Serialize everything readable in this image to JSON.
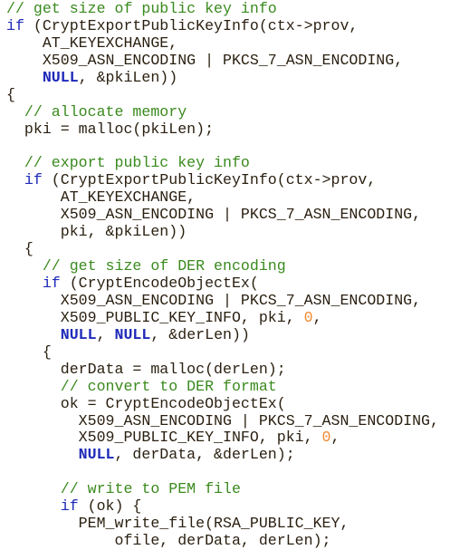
{
  "colors": {
    "comment": "#3a8a1e",
    "keyword": "#1f2ab8",
    "number": "#f08a30",
    "text": "#2a1f10"
  },
  "lines": [
    [
      {
        "k": "c",
        "s": "// get size of public key info"
      }
    ],
    [
      {
        "k": "k",
        "s": "if"
      },
      {
        "k": "t",
        "s": " (CryptExportPublicKeyInfo(ctx->prov,"
      }
    ],
    [
      {
        "k": "t",
        "s": "    AT_KEYEXCHANGE,"
      }
    ],
    [
      {
        "k": "t",
        "s": "    X509_ASN_ENCODING | PKCS_7_ASN_ENCODING,"
      }
    ],
    [
      {
        "k": "t",
        "s": "    "
      },
      {
        "k": "kb",
        "s": "NULL"
      },
      {
        "k": "t",
        "s": ", &pkiLen))"
      }
    ],
    [
      {
        "k": "t",
        "s": "{"
      }
    ],
    [
      {
        "k": "c",
        "s": "  // allocate memory"
      }
    ],
    [
      {
        "k": "t",
        "s": "  pki = malloc(pkiLen);"
      }
    ],
    [],
    [
      {
        "k": "c",
        "s": "  // export public key info"
      }
    ],
    [
      {
        "k": "t",
        "s": "  "
      },
      {
        "k": "k",
        "s": "if"
      },
      {
        "k": "t",
        "s": " (CryptExportPublicKeyInfo(ctx->prov,"
      }
    ],
    [
      {
        "k": "t",
        "s": "      AT_KEYEXCHANGE,"
      }
    ],
    [
      {
        "k": "t",
        "s": "      X509_ASN_ENCODING | PKCS_7_ASN_ENCODING,"
      }
    ],
    [
      {
        "k": "t",
        "s": "      pki, &pkiLen))"
      }
    ],
    [
      {
        "k": "t",
        "s": "  {"
      }
    ],
    [
      {
        "k": "c",
        "s": "    // get size of DER encoding"
      }
    ],
    [
      {
        "k": "t",
        "s": "    "
      },
      {
        "k": "k",
        "s": "if"
      },
      {
        "k": "t",
        "s": " (CryptEncodeObjectEx("
      }
    ],
    [
      {
        "k": "t",
        "s": "      X509_ASN_ENCODING | PKCS_7_ASN_ENCODING,"
      }
    ],
    [
      {
        "k": "t",
        "s": "      X509_PUBLIC_KEY_INFO, pki, "
      },
      {
        "k": "n",
        "s": "0"
      },
      {
        "k": "t",
        "s": ","
      }
    ],
    [
      {
        "k": "t",
        "s": "      "
      },
      {
        "k": "kb",
        "s": "NULL"
      },
      {
        "k": "t",
        "s": ", "
      },
      {
        "k": "kb",
        "s": "NULL"
      },
      {
        "k": "t",
        "s": ", &derLen))"
      }
    ],
    [
      {
        "k": "t",
        "s": "    {"
      }
    ],
    [
      {
        "k": "t",
        "s": "      derData = malloc(derLen);"
      }
    ],
    [
      {
        "k": "c",
        "s": "      // convert to DER format"
      }
    ],
    [
      {
        "k": "t",
        "s": "      ok = CryptEncodeObjectEx("
      }
    ],
    [
      {
        "k": "t",
        "s": "        X509_ASN_ENCODING | PKCS_7_ASN_ENCODING,"
      }
    ],
    [
      {
        "k": "t",
        "s": "        X509_PUBLIC_KEY_INFO, pki, "
      },
      {
        "k": "n",
        "s": "0"
      },
      {
        "k": "t",
        "s": ","
      }
    ],
    [
      {
        "k": "t",
        "s": "        "
      },
      {
        "k": "kb",
        "s": "NULL"
      },
      {
        "k": "t",
        "s": ", derData, &derLen);"
      }
    ],
    [],
    [
      {
        "k": "c",
        "s": "      // write to PEM file"
      }
    ],
    [
      {
        "k": "t",
        "s": "      "
      },
      {
        "k": "k",
        "s": "if"
      },
      {
        "k": "t",
        "s": " (ok) {"
      }
    ],
    [
      {
        "k": "t",
        "s": "        PEM_write_file(RSA_PUBLIC_KEY,"
      }
    ],
    [
      {
        "k": "t",
        "s": "            ofile, derData, derLen);"
      }
    ]
  ]
}
